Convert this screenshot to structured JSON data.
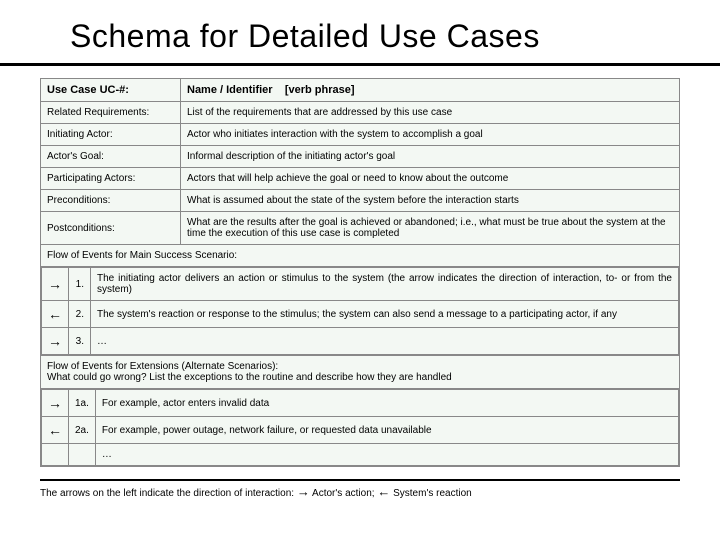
{
  "title": "Schema for Detailed Use Cases",
  "header": {
    "col1": "Use Case UC-#:",
    "col2": "Name / Identifier",
    "col3": "[verb phrase]"
  },
  "rows": [
    {
      "label": "Related Requirements:",
      "desc": "List of the requirements that are addressed by this use case"
    },
    {
      "label": "Initiating Actor:",
      "desc": "Actor who initiates interaction with the system to accomplish a goal"
    },
    {
      "label": "Actor's Goal:",
      "desc": "Informal description of the initiating actor's goal"
    },
    {
      "label": "Participating Actors:",
      "desc": "Actors that will help achieve the goal or need to know about the outcome"
    },
    {
      "label": "Preconditions:",
      "desc": "What is assumed about the state of the system before the interaction starts"
    },
    {
      "label": "Postconditions:",
      "desc": "What are the results after the goal is achieved or abandoned; i.e., what must be true about the system at the time the execution of this use case is completed"
    }
  ],
  "flowMainHeader": "Flow of Events for Main Success Scenario:",
  "flowMain": [
    {
      "arrow": "→",
      "num": "1.",
      "text": "The initiating actor delivers an action or stimulus to the system (the arrow indicates the direction of interaction, to- or from the system)"
    },
    {
      "arrow": "←",
      "num": "2.",
      "text": "The system's reaction or response to the stimulus; the system can also send a message to a participating actor, if any"
    },
    {
      "arrow": "→",
      "num": "3.",
      "text": "…"
    }
  ],
  "flowExtHeader1": "Flow of Events for Extensions (Alternate Scenarios):",
  "flowExtHeader2": "What could go wrong? List the exceptions to the routine and describe how they are handled",
  "flowExt": [
    {
      "arrow": "→",
      "num": "1a.",
      "text": "For example, actor enters invalid data"
    },
    {
      "arrow": "←",
      "num": "2a.",
      "text": "For example, power outage, network failure, or requested data unavailable"
    },
    {
      "arrow": "",
      "num": "",
      "text": "…"
    }
  ],
  "footer": {
    "prefix": "The arrows on the left indicate the direction of interaction: ",
    "a1": "→",
    "t1": " Actor's action; ",
    "a2": "←",
    "t2": " System's reaction"
  }
}
